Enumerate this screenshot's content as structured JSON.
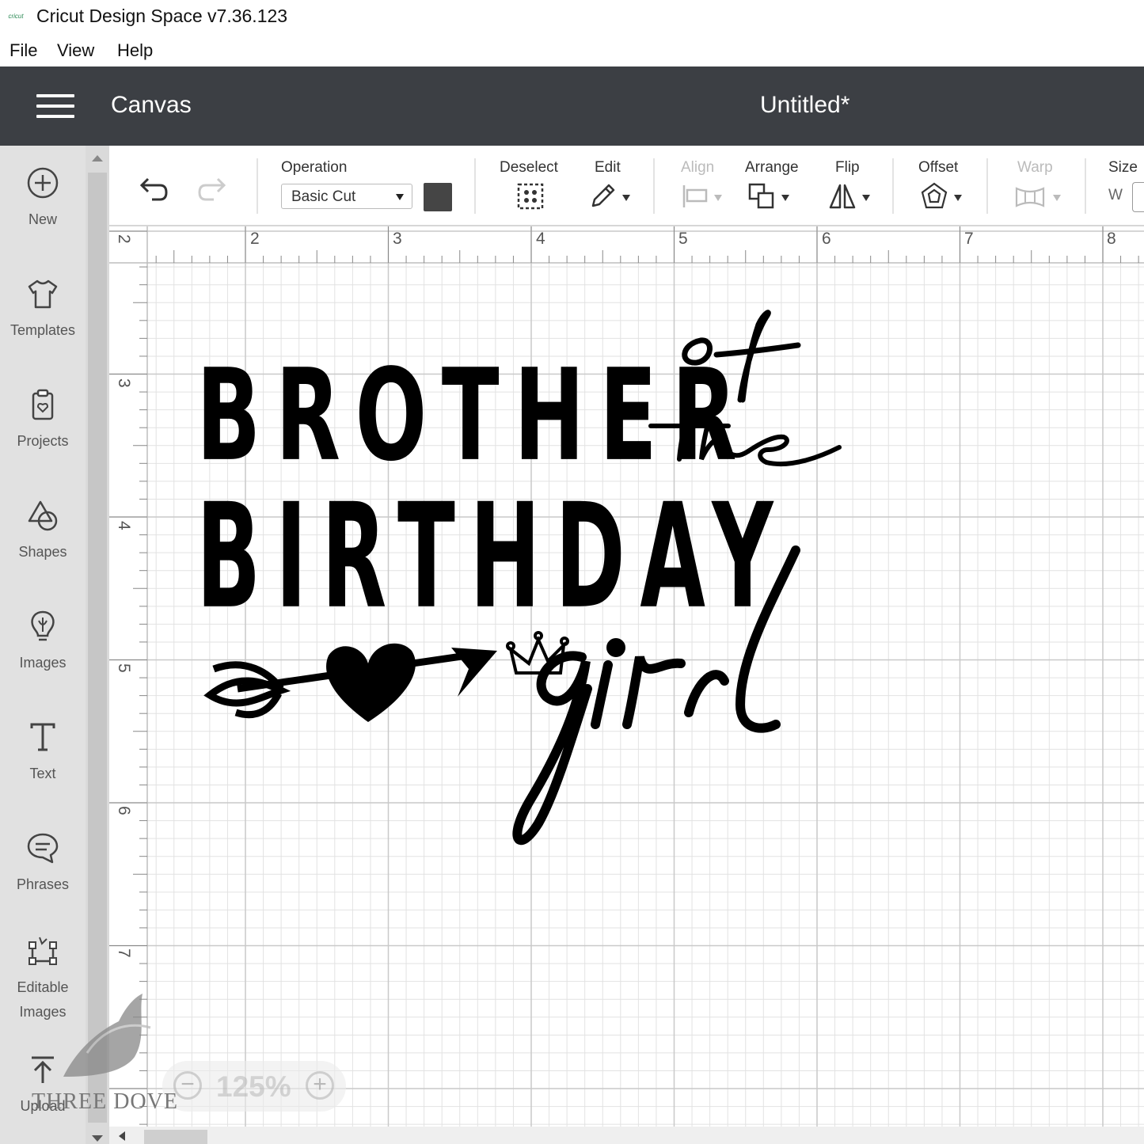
{
  "window": {
    "title": "Cricut Design Space  v7.36.123",
    "logo_text": "cricut"
  },
  "menu": {
    "items": [
      "File",
      "View",
      "Help"
    ]
  },
  "header": {
    "section": "Canvas",
    "document_title": "Untitled*"
  },
  "sidebar": {
    "items": [
      {
        "label": "New",
        "icon": "plus-circle-icon"
      },
      {
        "label": "Templates",
        "icon": "tshirt-icon"
      },
      {
        "label": "Projects",
        "icon": "clipboard-icon"
      },
      {
        "label": "Shapes",
        "icon": "shapes-icon"
      },
      {
        "label": "Images",
        "icon": "lightbulb-icon"
      },
      {
        "label": "Text",
        "icon": "text-t-icon"
      },
      {
        "label": "Phrases",
        "icon": "speech-bubble-icon"
      },
      {
        "label": "Editable Images",
        "icon": "edit-nodes-icon"
      },
      {
        "label": "Upload",
        "icon": "upload-icon"
      }
    ]
  },
  "toolbar": {
    "operation_label": "Operation",
    "operation_value": "Basic Cut",
    "operation_color": "#454545",
    "deselect_label": "Deselect",
    "edit_label": "Edit",
    "align_label": "Align",
    "arrange_label": "Arrange",
    "flip_label": "Flip",
    "offset_label": "Offset",
    "warp_label": "Warp",
    "size_label": "Size",
    "size_w_label": "W"
  },
  "ruler": {
    "horizontal": [
      "2",
      "3",
      "4",
      "5",
      "6",
      "7",
      "8"
    ],
    "vertical": [
      "2",
      "3",
      "4",
      "5",
      "6",
      "7"
    ]
  },
  "design": {
    "line1": "BROTHER",
    "line2": "BIRTHDAY",
    "script_of": "of",
    "script_the": "the",
    "script_girl": "girl",
    "fill_color": "#000000"
  },
  "zoom": {
    "value": "125%",
    "minus": "−",
    "plus": "+"
  },
  "watermark": {
    "text": "THREE DOVE"
  }
}
